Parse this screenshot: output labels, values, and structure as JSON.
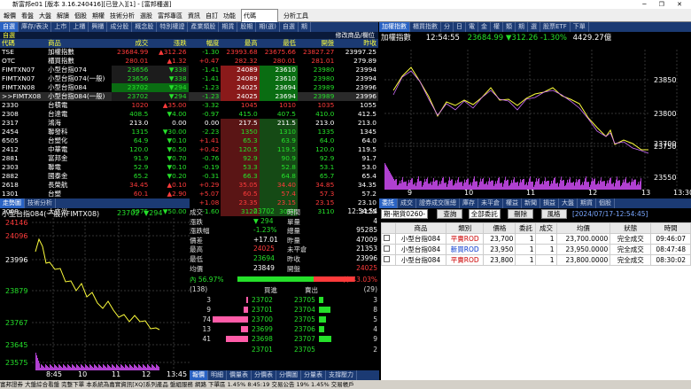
{
  "app": {
    "title": "新富邦e01 [版本 3.16.240416][已登入][1] - [富邦種選]",
    "window_controls": "─ ❐ ✕"
  },
  "toolbar": [
    "報價",
    "看盤",
    "大盤",
    "解讀",
    "個股",
    "期權",
    "技術分析",
    "選股",
    "富邦專區",
    "資訊",
    "自訂",
    "功能",
    "代碼",
    "分析工具"
  ],
  "quote_tabs": [
    "自選",
    "庫存/表決",
    "上市",
    "上櫃",
    "興櫃",
    "成分股",
    "概念股",
    "特別權證",
    "產業類股",
    "期貨",
    "股期",
    "期(選)",
    "自選",
    "期"
  ],
  "quote_header": {
    "label": "代碼",
    "sub": "自選",
    "tail": "修改商品/欄位"
  },
  "columns": [
    "代碼",
    "商品",
    "成交",
    "漲跌",
    "幅度",
    "最高",
    "最低",
    "開盤",
    "昨收"
  ],
  "rows": [
    [
      "TSE",
      "加權指數",
      "23684.99",
      "▲312.26",
      "-1.30",
      "23993.68",
      "23675.66",
      "23827.27",
      "23997.25"
    ],
    [
      "OTC",
      "櫃買指數",
      "280.01",
      "▲1.32",
      "+0.47",
      "282.32",
      "280.01",
      "281.01",
      "279.89"
    ],
    [
      "FIMTXN07",
      "小型台指074",
      "23656",
      "▼338",
      "-1.41",
      "24089",
      "23610",
      "23980",
      "23994"
    ],
    [
      "FIMTXN07",
      "小型台指074(一般)",
      "23656",
      "▼338",
      "-1.41",
      "24089",
      "23610",
      "23980",
      "23994"
    ],
    [
      "FIMTXN08",
      "小型台指084",
      "23702",
      "▼294",
      "-1.23",
      "24025",
      "23694",
      "23989",
      "23996"
    ],
    [
      ">>FIMTX08",
      "小型台指084(一般)",
      "23702",
      "▼294",
      "-1.23",
      "24025",
      "23694",
      "23989",
      "23996"
    ],
    [
      "2330",
      "台積電",
      "1020",
      "▲35.00",
      "-3.32",
      "1045",
      "1010",
      "1035",
      "1055"
    ],
    [
      "2308",
      "台達電",
      "408.5",
      "▼4.00",
      "-0.97",
      "415.0",
      "407.5",
      "410.0",
      "412.5"
    ],
    [
      "2317",
      "鴻海",
      "213.0",
      "0.00",
      "0.00",
      "217.5",
      "211.5",
      "213.0",
      "213.0"
    ],
    [
      "2454",
      "聯發科",
      "1315",
      "▼30.00",
      "-2.23",
      "1350",
      "1310",
      "1335",
      "1345"
    ],
    [
      "6505",
      "台塑化",
      "64.9",
      "▼0.10",
      "+1.41",
      "65.3",
      "63.9",
      "64.0",
      "64.0"
    ],
    [
      "2412",
      "中華電",
      "120.0",
      "▼0.50",
      "+0.42",
      "120.5",
      "119.5",
      "120.0",
      "119.5"
    ],
    [
      "2881",
      "富邦金",
      "91.9",
      "▼0.70",
      "-0.76",
      "92.9",
      "90.9",
      "92.9",
      "91.7"
    ],
    [
      "2303",
      "聯電",
      "52.9",
      "▼0.10",
      "-0.19",
      "53.3",
      "52.8",
      "53.1",
      "53.0"
    ],
    [
      "2882",
      "國泰金",
      "65.2",
      "▼0.20",
      "-0.31",
      "66.3",
      "64.8",
      "65.7",
      "65.4"
    ],
    [
      "2618",
      "長榮航",
      "34.45",
      "▲0.10",
      "+0.29",
      "35.05",
      "34.40",
      "34.85",
      "34.35"
    ],
    [
      "1301",
      "台塑",
      "60.1",
      "▲2.90",
      "+5.07",
      "60.5",
      "57.4",
      "57.3",
      "57.2"
    ],
    [
      "2002",
      "中鋼",
      "23.35",
      "▲0.25",
      "+1.08",
      "23.35",
      "23.15",
      "23.15",
      "23.10"
    ],
    [
      "3008",
      "大立光",
      "3075",
      "▼50.00",
      "-1.60",
      "3120",
      "3055",
      "3110",
      "3125"
    ]
  ],
  "index_panel": {
    "tabs": [
      "加權指數",
      "櫃買指數",
      "分",
      "日",
      "電",
      "金",
      "權",
      "類",
      "期",
      "選",
      "股票ETF",
      "下單"
    ],
    "name": "加權指數",
    "time": "12:54:55",
    "price": "23684.99",
    "change": "▼312.26",
    "pct": "-1.30%",
    "volume": "4429.27億",
    "yticks": [
      "23850",
      "23800",
      "23750",
      "23700",
      "23550"
    ],
    "xticks": [
      "9",
      "10",
      "11",
      "12",
      "13",
      "13:30"
    ]
  },
  "fut_chart": {
    "tabs": [
      "走勢圖",
      "技術分析"
    ],
    "name": "小型台指084(一般)(FIMTX08)",
    "price": "23702",
    "change": "▼294",
    "yticks": [
      "24146",
      "24096",
      "23996",
      "23879",
      "23767",
      "23645",
      "23575"
    ],
    "xticks": [
      "8:45",
      "10",
      "11",
      "12",
      "13:45"
    ]
  },
  "fut_info": {
    "left": [
      [
        "成交",
        "23702"
      ],
      [
        "漲跌",
        "▼ 294"
      ],
      [
        "漲跌幅",
        "-1.23%"
      ],
      [
        "價差",
        "+17.01"
      ],
      [
        "最高",
        "24025"
      ],
      [
        "最低",
        "23694"
      ],
      [
        "均價",
        "23849"
      ]
    ],
    "right": [
      [
        "時間",
        "12:54:54"
      ],
      [
        "單量",
        "4"
      ],
      [
        "總量",
        "95285"
      ],
      [
        "昨量",
        "47009"
      ],
      [
        "未平倉",
        "21353"
      ],
      [
        "昨收",
        "23996"
      ],
      [
        "開盤",
        "24025"
      ]
    ],
    "inner": "內 56.97%",
    "outer": "外 43.03%",
    "buy_total": "(138)",
    "sell_total": "(29)",
    "buy_label": "買進",
    "sell_label": "賣出",
    "book": [
      [
        "3",
        "23702",
        "23705",
        "3"
      ],
      [
        "9",
        "23701",
        "23704",
        "8"
      ],
      [
        "74",
        "23700",
        "23705",
        "5"
      ],
      [
        "13",
        "23699",
        "23706",
        "4"
      ],
      [
        "41",
        "23698",
        "23707",
        "9"
      ]
    ],
    "sum_buy": "23701",
    "sum_sell": "23705",
    "sum_cnt": "2"
  },
  "bottom_tabs": [
    "報價",
    "明細",
    "價量表",
    "分價表",
    "分價圖",
    "分量表",
    "支撐壓力"
  ],
  "order": {
    "tabs": [
      "委託",
      "成交",
      "證券成交匯總",
      "庫存",
      "未平倉",
      "權益",
      "新聞",
      "損益",
      "大盤",
      "期貨",
      "個股"
    ],
    "account": "期-期貨0260-",
    "query": "查詢",
    "filter": "全部委託",
    "delete": "刪除",
    "risk": "風格",
    "date": "[2024/07/17-12:54:45]",
    "columns": [
      "商品",
      "類別",
      "價格",
      "委託",
      "成交",
      "均價",
      "狀態",
      "時間"
    ],
    "rows": [
      [
        "小型台指084",
        "平賣ROD",
        "23,700",
        "1",
        "1",
        "23,700.0000",
        "完全成交",
        "09:46:07"
      ],
      [
        "小型台指084",
        "新買ROD",
        "23,950",
        "1",
        "1",
        "23,950.0000",
        "完全成交",
        "08:47:48"
      ],
      [
        "小型台指084",
        "平賣ROD",
        "23,800",
        "1",
        "1",
        "23,800.0000",
        "完全成交",
        "08:30:02"
      ]
    ]
  },
  "status": "富邦證券  大盤綜合看盤  完整下單  本系統為嘉實資訊[XQ]系列產品          盤組服務  網路  下單區  1.45%  8:45:19  交易公告  19%  1.45% 交易帳戶"
}
